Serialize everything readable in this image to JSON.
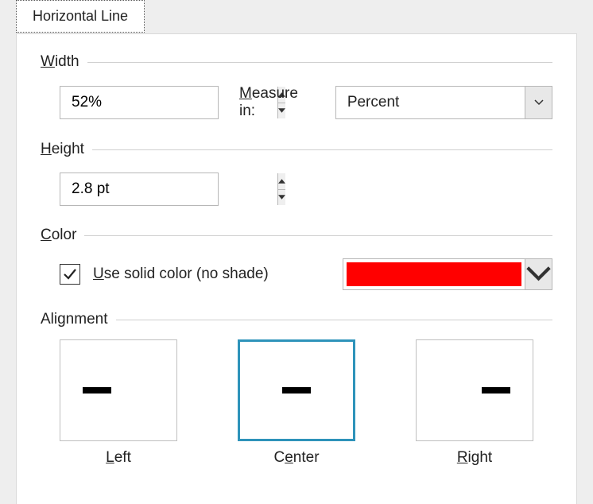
{
  "tab": {
    "label": "Horizontal Line"
  },
  "width": {
    "heading": "Width",
    "value": "52%",
    "measure_label": "Measure in:",
    "measure_value": "Percent"
  },
  "height": {
    "heading": "Height",
    "value": "2.8 pt"
  },
  "color": {
    "heading": "Color",
    "checkbox_checked": true,
    "checkbox_label": "Use solid color (no shade)",
    "swatch": "#ff0000"
  },
  "alignment": {
    "heading": "Alignment",
    "selected": "center",
    "options": {
      "left": "Left",
      "center": "Center",
      "right": "Right"
    }
  }
}
